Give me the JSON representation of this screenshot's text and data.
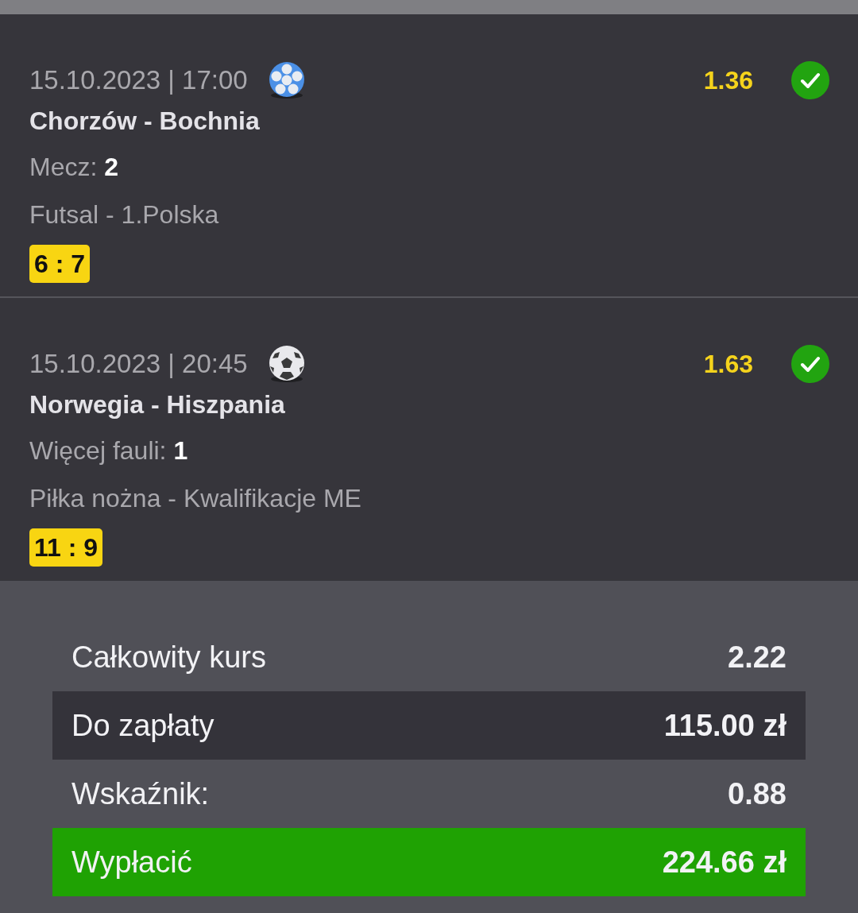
{
  "bets": [
    {
      "datetime": "15.10.2023 | 17:00",
      "odds": "1.36",
      "won": true,
      "teams": "Chorzów - Bochnia",
      "pick": "Mecz: **2**",
      "league": "Futsal - 1.Polska",
      "score": "6 : 7"
    },
    {
      "datetime": "15.10.2023 | 20:45",
      "odds": "1.63",
      "won": true,
      "teams": "Norwegia - Hiszpania",
      "pick": "Więcej fauli: **1**",
      "league": "Piłka nożna - Kwalifikacje ME",
      "score": "11 : 9"
    }
  ],
  "summary": [
    {
      "kind": "plain",
      "label": "Całkowity kurs",
      "value": "2.22"
    },
    {
      "kind": "dark",
      "label": "Do zapłaty",
      "value": "115.00 zł"
    },
    {
      "kind": "plain",
      "label": "Wskaźnik:",
      "value": "0.88"
    },
    {
      "kind": "green",
      "label": "Wypłacić",
      "value": "224.66 zł"
    }
  ]
}
